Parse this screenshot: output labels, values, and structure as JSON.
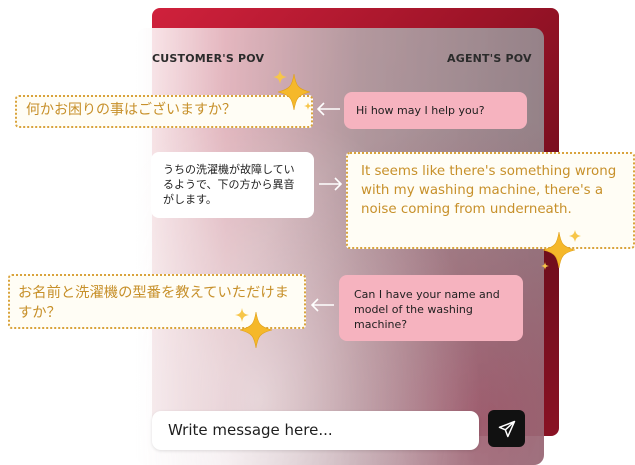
{
  "header": {
    "customer_pov": "CUSTOMER'S POV",
    "agent_pov": "AGENT'S POV"
  },
  "messages": {
    "agent_1": "Hi how may I help you?",
    "agent_1_translation": "何かお困りの事はございますか？",
    "customer_1": "うちの洗濯機が故障しているようで、下の方から異音がします。",
    "customer_1_translation": "It seems like there's something wrong with my washing machine, there's a noise coming from underneath.",
    "agent_2": "Can I have your name and model of the washing machine?",
    "agent_2_translation": "お名前と洗濯機の型番を教えていただけますか？"
  },
  "composer": {
    "placeholder": "Write message here...",
    "send_icon": "send-icon"
  },
  "colors": {
    "accent_red": "#b3182f",
    "agent_bubble": "#f6b3bf",
    "translation_gold": "#d9a33c"
  }
}
